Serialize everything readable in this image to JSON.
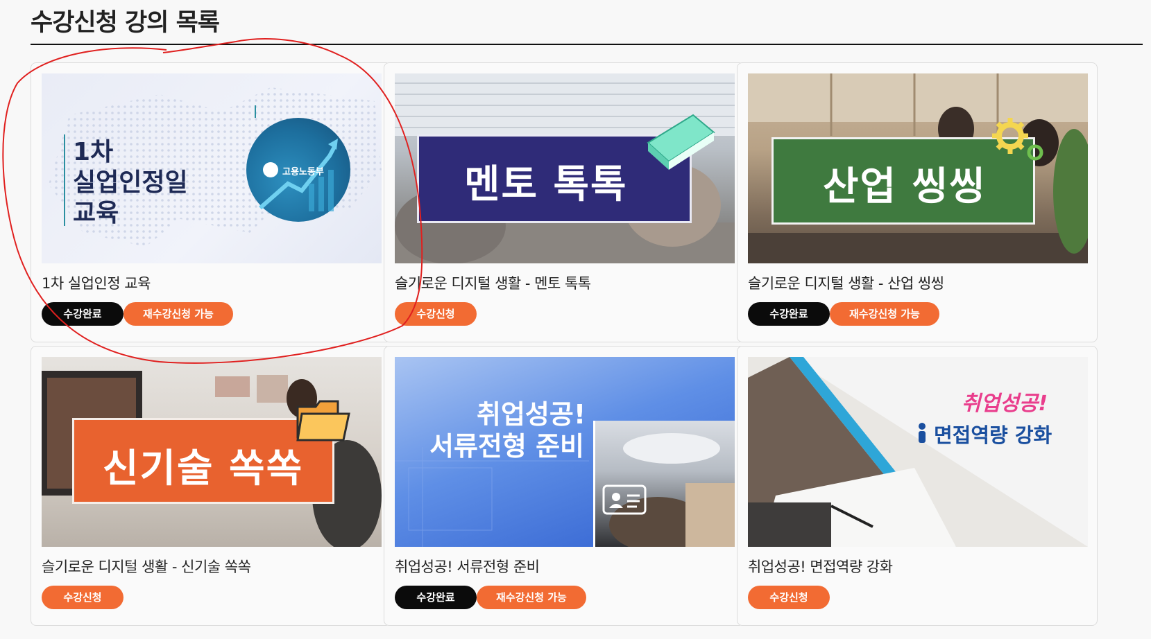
{
  "page": {
    "title": "수강신청 강의 목록"
  },
  "badges": {
    "done": "수강완료",
    "retake": "재수강신청 가능",
    "apply": "수강신청"
  },
  "colors": {
    "accent": "#f26b33",
    "done": "#0b0b0b",
    "annotation": "#e0201f"
  },
  "courses": [
    {
      "title": "1차 실업인정 교육",
      "thumb_lines": [
        "1차",
        "실업인정일",
        "교육"
      ],
      "thumb_logo": "고용노동부",
      "status": [
        "done",
        "retake"
      ]
    },
    {
      "title": "슬기로운 디지털 생활 - 멘토 톡톡",
      "thumb_text": "멘토 톡톡",
      "thumb_icon": "book-icon",
      "status": [
        "apply"
      ]
    },
    {
      "title": "슬기로운 디지털 생활 - 산업 씽씽",
      "thumb_text": "산업 씽씽",
      "thumb_icon": "gear-icon",
      "status": [
        "done",
        "retake"
      ]
    },
    {
      "title": "슬기로운 디지털 생활 - 신기술 쏙쏙",
      "thumb_text": "신기술 쏙쏙",
      "thumb_icon": "folder-icon",
      "status": [
        "apply"
      ]
    },
    {
      "title": "취업성공! 서류전형 준비",
      "thumb_lines": [
        "취업성공!",
        "서류전형 준비"
      ],
      "thumb_icon": "id-card-icon",
      "status": [
        "done",
        "retake"
      ]
    },
    {
      "title": "취업성공! 면접역량 강화",
      "thumb_lines": [
        "취업성공!",
        "면접역량 강화"
      ],
      "thumb_icon": "person-icon",
      "status": [
        "apply"
      ]
    }
  ]
}
